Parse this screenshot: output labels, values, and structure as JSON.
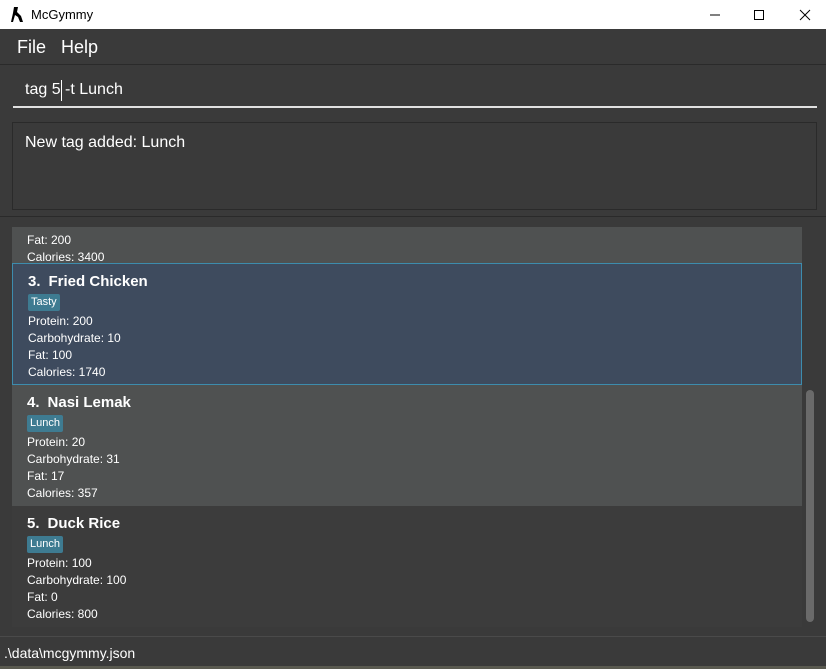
{
  "window": {
    "title": "McGymmy"
  },
  "menu": {
    "file": "File",
    "help": "Help"
  },
  "command": {
    "value": "tag 5 -t Lunch"
  },
  "result": {
    "message": "New tag added: Lunch"
  },
  "list": {
    "partial": {
      "fat": "Fat: 200",
      "calories": "Calories: 3400"
    },
    "items": [
      {
        "index": "3.",
        "name": "Fried Chicken",
        "tag": "Tasty",
        "protein": "Protein: 200",
        "carbohydrate": "Carbohydrate: 10",
        "fat": "Fat: 100",
        "calories": "Calories: 1740"
      },
      {
        "index": "4.",
        "name": "Nasi Lemak",
        "tag": "Lunch",
        "protein": "Protein: 20",
        "carbohydrate": "Carbohydrate: 31",
        "fat": "Fat: 17",
        "calories": "Calories: 357"
      },
      {
        "index": "5.",
        "name": "Duck Rice",
        "tag": "Lunch",
        "protein": "Protein: 100",
        "carbohydrate": "Carbohydrate: 100",
        "fat": "Fat: 0",
        "calories": "Calories: 800"
      }
    ]
  },
  "status": {
    "path": ".\\data\\mcgymmy.json"
  },
  "colors": {
    "tag_bg": "#3e7b91",
    "selected_border": "#3d8cad",
    "selected_bg": "#3e4b5e"
  }
}
